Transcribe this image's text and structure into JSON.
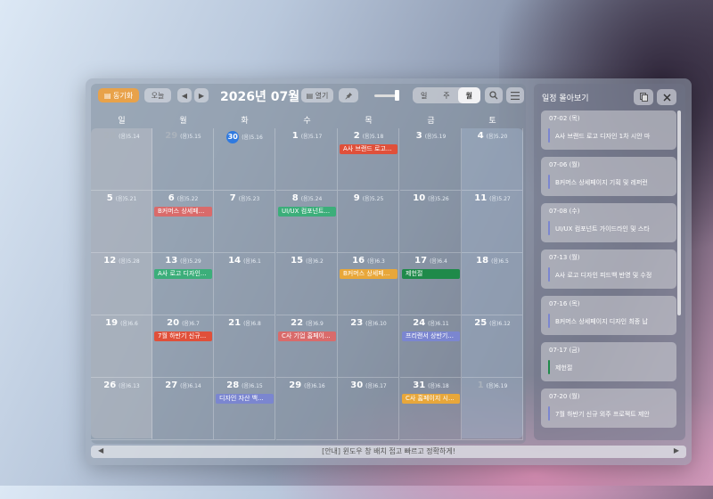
{
  "toolbar": {
    "today_label": "▤ 동기화",
    "today_btn": "오늘",
    "prev": "◀",
    "next": "▶",
    "title": "2026년 07월",
    "open_label": "▤ 열기",
    "pin_icon": "pin-icon",
    "views": [
      "일",
      "주",
      "월"
    ],
    "active_view": "월",
    "search_icon": "search-icon",
    "menu_icon": "menu-icon"
  },
  "weekdays": [
    "일",
    "월",
    "화",
    "수",
    "목",
    "금",
    "토"
  ],
  "weeks": [
    [
      {
        "d": "28",
        "l": "(음)5.14",
        "dim": true
      },
      {
        "d": "29",
        "l": "(음)5.15",
        "dim": true
      },
      {
        "d": "30",
        "l": "(음)5.16",
        "today": true
      },
      {
        "d": "1",
        "l": "(음)5.17"
      },
      {
        "d": "2",
        "l": "(음)5.18"
      },
      {
        "d": "3",
        "l": "(음)5.19"
      },
      {
        "d": "4",
        "l": "(음)5.20"
      }
    ],
    [
      {
        "d": "5",
        "l": "(음)5.21"
      },
      {
        "d": "6",
        "l": "(음)5.22"
      },
      {
        "d": "7",
        "l": "(음)5.23"
      },
      {
        "d": "8",
        "l": "(음)5.24"
      },
      {
        "d": "9",
        "l": "(음)5.25"
      },
      {
        "d": "10",
        "l": "(음)5.26"
      },
      {
        "d": "11",
        "l": "(음)5.27"
      }
    ],
    [
      {
        "d": "12",
        "l": "(음)5.28"
      },
      {
        "d": "13",
        "l": "(음)5.29"
      },
      {
        "d": "14",
        "l": "(음)6.1"
      },
      {
        "d": "15",
        "l": "(음)6.2"
      },
      {
        "d": "16",
        "l": "(음)6.3"
      },
      {
        "d": "17",
        "l": "(음)6.4"
      },
      {
        "d": "18",
        "l": "(음)6.5"
      }
    ],
    [
      {
        "d": "19",
        "l": "(음)6.6"
      },
      {
        "d": "20",
        "l": "(음)6.7"
      },
      {
        "d": "21",
        "l": "(음)6.8"
      },
      {
        "d": "22",
        "l": "(음)6.9"
      },
      {
        "d": "23",
        "l": "(음)6.10"
      },
      {
        "d": "24",
        "l": "(음)6.11"
      },
      {
        "d": "25",
        "l": "(음)6.12"
      }
    ],
    [
      {
        "d": "26",
        "l": "(음)6.13"
      },
      {
        "d": "27",
        "l": "(음)6.14"
      },
      {
        "d": "28",
        "l": "(음)6.15"
      },
      {
        "d": "29",
        "l": "(음)6.16"
      },
      {
        "d": "30",
        "l": "(음)6.17"
      },
      {
        "d": "31",
        "l": "(음)6.18"
      },
      {
        "d": "1",
        "l": "(음)6.19",
        "dim": true
      }
    ]
  ],
  "events": [
    {
      "w": 0,
      "c": 4,
      "text": "A사 브랜드 로고...",
      "color": "#e0503a"
    },
    {
      "w": 1,
      "c": 1,
      "text": "B커머스 상세페...",
      "color": "#d96b6b"
    },
    {
      "w": 1,
      "c": 3,
      "text": "UI/UX 컴포넌트...",
      "color": "#3cae7a"
    },
    {
      "w": 2,
      "c": 1,
      "text": "A사 로고 디자인...",
      "color": "#3cae7a"
    },
    {
      "w": 2,
      "c": 4,
      "text": "B커머스 상세페...",
      "color": "#e8a73a"
    },
    {
      "w": 2,
      "c": 5,
      "text": "제헌절",
      "color": "#1f8a4a"
    },
    {
      "w": 3,
      "c": 1,
      "text": "7월 하반기 신규...",
      "color": "#e0503a"
    },
    {
      "w": 3,
      "c": 3,
      "text": "C사 기업 홈페이...",
      "color": "#d96b6b"
    },
    {
      "w": 3,
      "c": 5,
      "text": "프리랜서 상반기...",
      "color": "#7b86d0"
    },
    {
      "w": 4,
      "c": 2,
      "text": "디자인 자산 백...",
      "color": "#7b86d0"
    },
    {
      "w": 4,
      "c": 5,
      "text": "C사 홈페이지 시...",
      "color": "#e8a73a"
    }
  ],
  "sidebar": {
    "title": "일정 몰아보기",
    "copy_icon": "copy-icon",
    "close_icon": "close-icon",
    "items": [
      {
        "date": "07-02 (목)",
        "text": "A사 브랜드 로고 디자인 1차 시안 마",
        "color": "#7b86d0"
      },
      {
        "date": "07-06 (월)",
        "text": "B커머스 상세페이지 기획 및 레퍼런",
        "color": "#7b86d0"
      },
      {
        "date": "07-08 (수)",
        "text": "UI/UX 컴포넌트 가이드라인 및 스타",
        "color": "#7b86d0"
      },
      {
        "date": "07-13 (월)",
        "text": "A사 로고 디자인 피드백 반영 및 수정",
        "color": "#7b86d0"
      },
      {
        "date": "07-16 (목)",
        "text": "B커머스 상세페이지 디자인 최종 납",
        "color": "#7b86d0"
      },
      {
        "date": "07-17 (금)",
        "text": "제헌절",
        "color": "#1f8a4a"
      },
      {
        "date": "07-20 (월)",
        "text": "7월 하반기 신규 외주 프로젝트 제안",
        "color": "#7b86d0"
      }
    ]
  },
  "footer": {
    "message": "[안내] 윈도우 창 배치 접고 빠르고 정확하게!",
    "left": "◀",
    "right": "▶"
  }
}
